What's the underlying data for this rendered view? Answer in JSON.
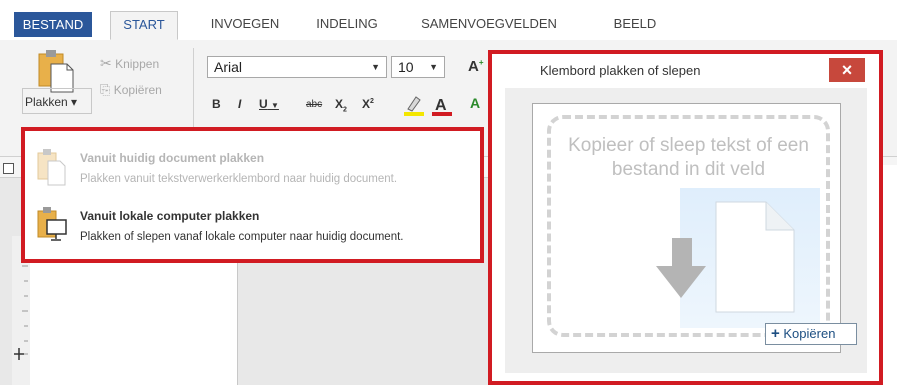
{
  "tabs": {
    "file": "BESTAND",
    "start": "START",
    "insert": "INVOEGEN",
    "layout": "INDELING",
    "mailmerge": "SAMENVOEGVELDEN",
    "view": "BEELD"
  },
  "ribbon": {
    "paste_label": "Plakken",
    "cut_label": "Knippen",
    "copy_label": "Kopiëren",
    "font_name": "Arial",
    "font_size": "10",
    "bold": "B",
    "italic": "I",
    "underline": "U",
    "strike": "abc",
    "subscript": "X",
    "superscript": "X"
  },
  "paste_menu": {
    "items": [
      {
        "title": "Vanuit huidig document plakken",
        "desc": "Plakken vanuit tekstverwerkerklembord naar huidig document.",
        "enabled": false
      },
      {
        "title": "Vanuit lokale computer plakken",
        "desc": "Plakken of slepen vanaf lokale computer naar huidig document.",
        "enabled": true
      }
    ]
  },
  "dialog": {
    "title": "Klembord plakken of slepen",
    "close": "×",
    "drop_text": "Kopieer of sleep tekst of een bestand in dit veld",
    "copy_button": "Kopiëren",
    "copy_plus": "+"
  },
  "colors": {
    "accent": "#2b579a",
    "highlight_red": "#d11b22",
    "close_red": "#c7483c"
  }
}
